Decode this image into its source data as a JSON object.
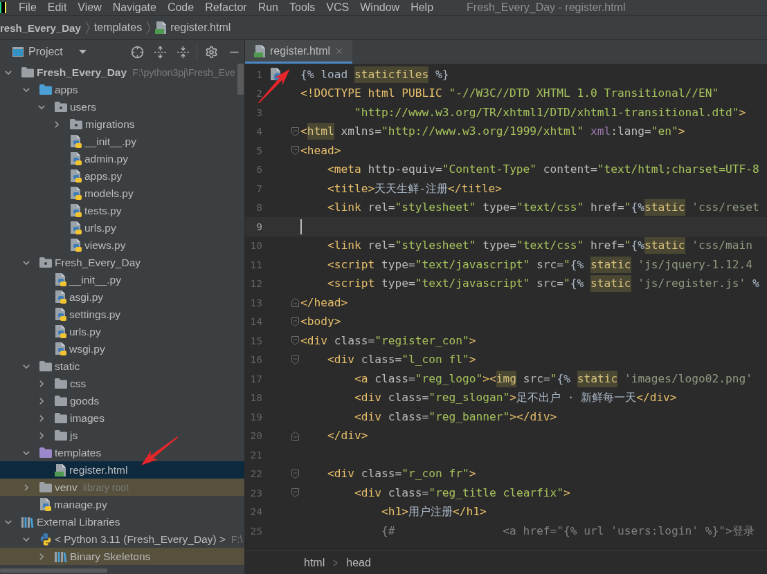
{
  "menu_bar": {
    "items": [
      "File",
      "Edit",
      "View",
      "Navigate",
      "Code",
      "Refactor",
      "Run",
      "Tools",
      "VCS",
      "Window",
      "Help"
    ],
    "window_title": "Fresh_Every_Day - register.html"
  },
  "navigation_bar": {
    "crumbs": [
      {
        "label": "resh_Every_Day",
        "kind": "project"
      },
      {
        "label": "templates",
        "kind": "folder"
      },
      {
        "label": "register.html",
        "kind": "html"
      }
    ]
  },
  "project_panel": {
    "title": "Project",
    "tree": [
      {
        "label": "Fresh_Every_Day",
        "kind": "project",
        "hint": "F:\\python3pj\\Fresh_Eve",
        "expanded": true,
        "selected": false,
        "highlighted": false,
        "children": [
          {
            "label": "apps",
            "kind": "source_folder",
            "expanded": true,
            "selected": false,
            "highlighted": false,
            "children": [
              {
                "label": "users",
                "kind": "module",
                "expanded": true,
                "selected": false,
                "highlighted": false,
                "children": [
                  {
                    "label": "migrations",
                    "kind": "module",
                    "expanded": false,
                    "selected": false,
                    "highlighted": false
                  },
                  {
                    "label": "__init__.py",
                    "kind": "python",
                    "selected": false,
                    "highlighted": false
                  },
                  {
                    "label": "admin.py",
                    "kind": "python",
                    "selected": false,
                    "highlighted": false
                  },
                  {
                    "label": "apps.py",
                    "kind": "python",
                    "selected": false,
                    "highlighted": false
                  },
                  {
                    "label": "models.py",
                    "kind": "python",
                    "selected": false,
                    "highlighted": false
                  },
                  {
                    "label": "tests.py",
                    "kind": "python",
                    "selected": false,
                    "highlighted": false
                  },
                  {
                    "label": "urls.py",
                    "kind": "python",
                    "selected": false,
                    "highlighted": false
                  },
                  {
                    "label": "views.py",
                    "kind": "python",
                    "selected": false,
                    "highlighted": false
                  }
                ]
              }
            ]
          },
          {
            "label": "Fresh_Every_Day",
            "kind": "module",
            "expanded": true,
            "selected": false,
            "highlighted": false,
            "children": [
              {
                "label": "__init__.py",
                "kind": "python",
                "selected": false,
                "highlighted": false
              },
              {
                "label": "asgi.py",
                "kind": "python",
                "selected": false,
                "highlighted": false
              },
              {
                "label": "settings.py",
                "kind": "python",
                "selected": false,
                "highlighted": false
              },
              {
                "label": "urls.py",
                "kind": "python",
                "selected": false,
                "highlighted": false
              },
              {
                "label": "wsgi.py",
                "kind": "python",
                "selected": false,
                "highlighted": false
              }
            ]
          },
          {
            "label": "static",
            "kind": "folder",
            "expanded": true,
            "selected": false,
            "highlighted": false,
            "children": [
              {
                "label": "css",
                "kind": "folder",
                "expanded": false,
                "selected": false,
                "highlighted": false
              },
              {
                "label": "goods",
                "kind": "folder",
                "expanded": false,
                "selected": false,
                "highlighted": false
              },
              {
                "label": "images",
                "kind": "folder",
                "expanded": false,
                "selected": false,
                "highlighted": false
              },
              {
                "label": "js",
                "kind": "folder",
                "expanded": false,
                "selected": false,
                "highlighted": false
              }
            ]
          },
          {
            "label": "templates",
            "kind": "templates_folder",
            "expanded": true,
            "selected": false,
            "highlighted": false,
            "children": [
              {
                "label": "register.html",
                "kind": "html",
                "selected": true,
                "highlighted": false
              }
            ]
          },
          {
            "label": "venv",
            "kind": "folder",
            "hint": "library root",
            "expanded": false,
            "selected": false,
            "highlighted": true
          },
          {
            "label": "manage.py",
            "kind": "python",
            "selected": false,
            "highlighted": false
          }
        ]
      },
      {
        "label": "External Libraries",
        "kind": "libraries",
        "expanded": true,
        "selected": false,
        "highlighted": false,
        "children": [
          {
            "label": "< Python 3.11 (Fresh_Every_Day) >",
            "kind": "sdk",
            "hint": "F:\\",
            "expanded": true,
            "selected": false,
            "highlighted": false,
            "children": [
              {
                "label": "Binary Skeletons",
                "kind": "library",
                "expanded": false,
                "selected": false,
                "highlighted": true
              }
            ]
          }
        ]
      }
    ]
  },
  "editor": {
    "tabs": [
      {
        "label": "register.html",
        "kind": "html",
        "selected": true
      }
    ],
    "lines": [
      {
        "number": "1",
        "current": false,
        "gutter_icon": true,
        "tokens": [
          {
            "text": "{% load ",
            "kind": "plain"
          },
          {
            "text": "staticfiles",
            "kind": "marked"
          },
          {
            "text": " %}",
            "kind": "plain"
          }
        ]
      },
      {
        "number": "2",
        "current": false,
        "tokens": [
          {
            "text": "<!DOCTYPE html PUBLIC ",
            "kind": "tag"
          },
          {
            "text": "\"-//W3C//DTD XHTML 1.0 Transitional//EN\"",
            "kind": "string"
          }
        ]
      },
      {
        "number": "3",
        "current": false,
        "tokens": [
          {
            "text": "        \"http://www.w3.org/TR/xhtml1/DTD/xhtml1-transitional.dtd\"",
            "kind": "string"
          },
          {
            "text": ">",
            "kind": "tag"
          }
        ]
      },
      {
        "number": "4",
        "current": false,
        "fold_start": true,
        "tokens": [
          {
            "text": "<",
            "kind": "tag"
          },
          {
            "text": "html",
            "kind": "marked"
          },
          {
            "text": " xmlns=",
            "kind": "attr"
          },
          {
            "text": "\"http://www.w3.org/1999/xhtml\"",
            "kind": "string"
          },
          {
            "text": " xml",
            "kind": "namespace"
          },
          {
            "text": ":lang=",
            "kind": "attr"
          },
          {
            "text": "\"en\"",
            "kind": "string"
          },
          {
            "text": ">",
            "kind": "tag"
          }
        ]
      },
      {
        "number": "5",
        "current": false,
        "fold_start": true,
        "tokens": [
          {
            "text": "<head>",
            "kind": "tag"
          }
        ]
      },
      {
        "number": "6",
        "current": false,
        "tokens": [
          {
            "text": "    <meta",
            "kind": "tag"
          },
          {
            "text": " http-equiv=",
            "kind": "attr"
          },
          {
            "text": "\"Content-Type\"",
            "kind": "string"
          },
          {
            "text": " content=",
            "kind": "attr"
          },
          {
            "text": "\"text/html;charset=UTF-8",
            "kind": "string"
          }
        ]
      },
      {
        "number": "7",
        "current": false,
        "tokens": [
          {
            "text": "    <title>",
            "kind": "tag"
          },
          {
            "text": "天天生鲜-注册",
            "kind": "plain"
          },
          {
            "text": "</title>",
            "kind": "tag"
          }
        ]
      },
      {
        "number": "8",
        "current": false,
        "tokens": [
          {
            "text": "    <link",
            "kind": "tag"
          },
          {
            "text": " rel=",
            "kind": "attr"
          },
          {
            "text": "\"stylesheet\"",
            "kind": "string"
          },
          {
            "text": " type=",
            "kind": "attr"
          },
          {
            "text": "\"text/css\"",
            "kind": "string"
          },
          {
            "text": " href=",
            "kind": "attr"
          },
          {
            "text": "\"",
            "kind": "string"
          },
          {
            "text": "{%",
            "kind": "plain"
          },
          {
            "text": "static",
            "kind": "marked"
          },
          {
            "text": " 'css/reset",
            "kind": "tstring"
          }
        ]
      },
      {
        "number": "9",
        "current": true
      },
      {
        "number": "10",
        "current": false,
        "tokens": [
          {
            "text": "    <link",
            "kind": "tag"
          },
          {
            "text": " rel=",
            "kind": "attr"
          },
          {
            "text": "\"stylesheet\"",
            "kind": "string"
          },
          {
            "text": " type=",
            "kind": "attr"
          },
          {
            "text": "\"text/css\"",
            "kind": "string"
          },
          {
            "text": " href=",
            "kind": "attr"
          },
          {
            "text": "\"",
            "kind": "string"
          },
          {
            "text": "{%",
            "kind": "plain"
          },
          {
            "text": "static",
            "kind": "marked"
          },
          {
            "text": " 'css/main",
            "kind": "tstring"
          }
        ]
      },
      {
        "number": "11",
        "current": false,
        "tokens": [
          {
            "text": "    <script",
            "kind": "tag"
          },
          {
            "text": " type=",
            "kind": "attr"
          },
          {
            "text": "\"text/javascript\"",
            "kind": "string"
          },
          {
            "text": " src=",
            "kind": "attr"
          },
          {
            "text": "\"",
            "kind": "string"
          },
          {
            "text": "{% ",
            "kind": "plain"
          },
          {
            "text": "static",
            "kind": "marked"
          },
          {
            "text": " 'js/jquery-1.12.4",
            "kind": "tstring"
          }
        ]
      },
      {
        "number": "12",
        "current": false,
        "tokens": [
          {
            "text": "    <script",
            "kind": "tag"
          },
          {
            "text": " type=",
            "kind": "attr"
          },
          {
            "text": "\"text/javascript\"",
            "kind": "string"
          },
          {
            "text": " src=",
            "kind": "attr"
          },
          {
            "text": "\"",
            "kind": "string"
          },
          {
            "text": "{% ",
            "kind": "plain"
          },
          {
            "text": "static",
            "kind": "marked"
          },
          {
            "text": " 'js/register.js'",
            "kind": "tstring"
          },
          {
            "text": " %",
            "kind": "plain"
          }
        ]
      },
      {
        "number": "13",
        "current": false,
        "fold_end": true,
        "tokens": [
          {
            "text": "</head>",
            "kind": "tag"
          }
        ]
      },
      {
        "number": "14",
        "current": false,
        "fold_start": true,
        "tokens": [
          {
            "text": "<body>",
            "kind": "tag"
          }
        ]
      },
      {
        "number": "15",
        "current": false,
        "fold_start": true,
        "tokens": [
          {
            "text": "<div",
            "kind": "tag"
          },
          {
            "text": " class=",
            "kind": "attr"
          },
          {
            "text": "\"register_con\"",
            "kind": "string"
          },
          {
            "text": ">",
            "kind": "tag"
          }
        ]
      },
      {
        "number": "16",
        "current": false,
        "fold_start": true,
        "tokens": [
          {
            "text": "    <div",
            "kind": "tag"
          },
          {
            "text": " class=",
            "kind": "attr"
          },
          {
            "text": "\"l_con fl\"",
            "kind": "string"
          },
          {
            "text": ">",
            "kind": "tag"
          }
        ]
      },
      {
        "number": "17",
        "current": false,
        "tokens": [
          {
            "text": "        <a",
            "kind": "tag"
          },
          {
            "text": " class=",
            "kind": "attr"
          },
          {
            "text": "\"reg_logo\"",
            "kind": "string"
          },
          {
            "text": "><",
            "kind": "tag"
          },
          {
            "text": "img",
            "kind": "marked"
          },
          {
            "text": " src=",
            "kind": "attr"
          },
          {
            "text": "\"",
            "kind": "string"
          },
          {
            "text": "{% ",
            "kind": "plain"
          },
          {
            "text": "static",
            "kind": "marked"
          },
          {
            "text": " 'images/logo02.png'",
            "kind": "tstring"
          }
        ]
      },
      {
        "number": "18",
        "current": false,
        "tokens": [
          {
            "text": "        <div",
            "kind": "tag"
          },
          {
            "text": " class=",
            "kind": "attr"
          },
          {
            "text": "\"reg_slogan\"",
            "kind": "string"
          },
          {
            "text": ">",
            "kind": "tag"
          },
          {
            "text": "足不出户 · 新鲜每一天",
            "kind": "plain"
          },
          {
            "text": "</div>",
            "kind": "tag"
          }
        ]
      },
      {
        "number": "19",
        "current": false,
        "tokens": [
          {
            "text": "        <div",
            "kind": "tag"
          },
          {
            "text": " class=",
            "kind": "attr"
          },
          {
            "text": "\"reg_banner\"",
            "kind": "string"
          },
          {
            "text": "></div>",
            "kind": "tag"
          }
        ]
      },
      {
        "number": "20",
        "current": false,
        "fold_end": true,
        "tokens": [
          {
            "text": "    </div>",
            "kind": "tag"
          }
        ]
      },
      {
        "number": "21",
        "current": false
      },
      {
        "number": "22",
        "current": false,
        "fold_start": true,
        "tokens": [
          {
            "text": "    <div",
            "kind": "tag"
          },
          {
            "text": " class=",
            "kind": "attr"
          },
          {
            "text": "\"r_con fr\"",
            "kind": "string"
          },
          {
            "text": ">",
            "kind": "tag"
          }
        ]
      },
      {
        "number": "23",
        "current": false,
        "fold_start": true,
        "tokens": [
          {
            "text": "        <div",
            "kind": "tag"
          },
          {
            "text": " class=",
            "kind": "attr"
          },
          {
            "text": "\"reg_title clearfix\"",
            "kind": "string"
          },
          {
            "text": ">",
            "kind": "tag"
          }
        ]
      },
      {
        "number": "24",
        "current": false,
        "tokens": [
          {
            "text": "            <h1>",
            "kind": "tag"
          },
          {
            "text": "用户注册",
            "kind": "plain"
          },
          {
            "text": "</h1>",
            "kind": "tag"
          }
        ]
      },
      {
        "number": "25",
        "current": false,
        "tokens": [
          {
            "text": "            {#                <a href=\"{% url 'users:login' %}\">登录",
            "kind": "comment"
          }
        ]
      }
    ],
    "breadcrumbs": [
      "html",
      "head"
    ]
  }
}
